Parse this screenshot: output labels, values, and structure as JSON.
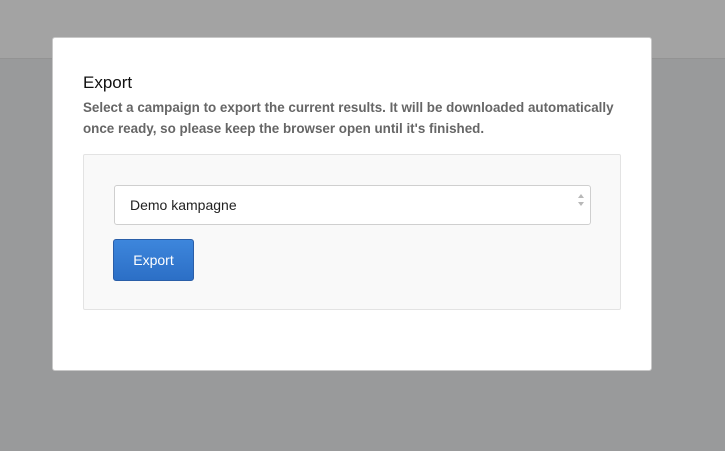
{
  "modal": {
    "title": "Export",
    "description": "Select a campaign to export the current results. It will be downloaded automatically once ready, so please keep the browser open until it's finished."
  },
  "campaign_select": {
    "selected_value": "Demo kampagne",
    "icon": "sort-arrows-icon"
  },
  "actions": {
    "export_label": "Export",
    "accent_color": "#2f74cf"
  }
}
